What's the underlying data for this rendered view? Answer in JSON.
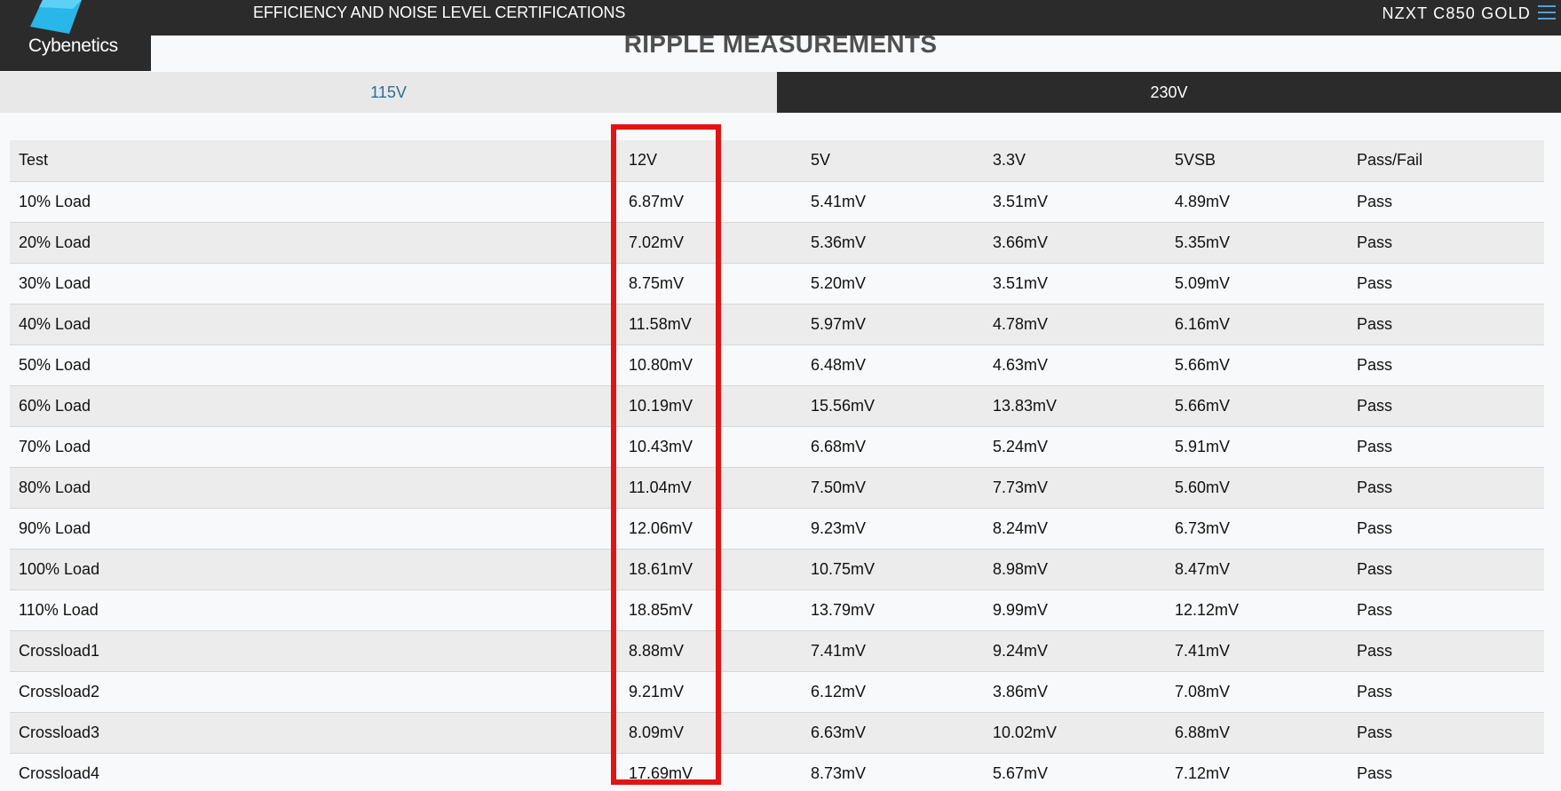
{
  "header": {
    "brand": "Cybenetics",
    "nav_link": "EFFICIENCY AND NOISE LEVEL CERTIFICATIONS",
    "product": "NZXT C850 GOLD",
    "menu_icon": "hamburger-menu-icon",
    "accent_color": "#4aa3df"
  },
  "section": {
    "title": "RIPPLE MEASUREMENTS"
  },
  "tabs": [
    {
      "label": "115V",
      "active": false
    },
    {
      "label": "230V",
      "active": true
    }
  ],
  "table": {
    "headers": [
      "Test",
      "12V",
      "5V",
      "3.3V",
      "5VSB",
      "Pass/Fail"
    ],
    "rows": [
      [
        "10% Load",
        "6.87mV",
        "5.41mV",
        "3.51mV",
        "4.89mV",
        "Pass"
      ],
      [
        "20% Load",
        "7.02mV",
        "5.36mV",
        "3.66mV",
        "5.35mV",
        "Pass"
      ],
      [
        "30% Load",
        "8.75mV",
        "5.20mV",
        "3.51mV",
        "5.09mV",
        "Pass"
      ],
      [
        "40% Load",
        "11.58mV",
        "5.97mV",
        "4.78mV",
        "6.16mV",
        "Pass"
      ],
      [
        "50% Load",
        "10.80mV",
        "6.48mV",
        "4.63mV",
        "5.66mV",
        "Pass"
      ],
      [
        "60% Load",
        "10.19mV",
        "15.56mV",
        "13.83mV",
        "5.66mV",
        "Pass"
      ],
      [
        "70% Load",
        "10.43mV",
        "6.68mV",
        "5.24mV",
        "5.91mV",
        "Pass"
      ],
      [
        "80% Load",
        "11.04mV",
        "7.50mV",
        "7.73mV",
        "5.60mV",
        "Pass"
      ],
      [
        "90% Load",
        "12.06mV",
        "9.23mV",
        "8.24mV",
        "6.73mV",
        "Pass"
      ],
      [
        "100% Load",
        "18.61mV",
        "10.75mV",
        "8.98mV",
        "8.47mV",
        "Pass"
      ],
      [
        "110% Load",
        "18.85mV",
        "13.79mV",
        "9.99mV",
        "12.12mV",
        "Pass"
      ],
      [
        "Crossload1",
        "8.88mV",
        "7.41mV",
        "9.24mV",
        "7.41mV",
        "Pass"
      ],
      [
        "Crossload2",
        "9.21mV",
        "6.12mV",
        "3.86mV",
        "7.08mV",
        "Pass"
      ],
      [
        "Crossload3",
        "8.09mV",
        "6.63mV",
        "10.02mV",
        "6.88mV",
        "Pass"
      ],
      [
        "Crossload4",
        "17.69mV",
        "8.73mV",
        "5.67mV",
        "7.12mV",
        "Pass"
      ]
    ]
  },
  "highlight": {
    "column": "12V",
    "color": "#e01414"
  }
}
